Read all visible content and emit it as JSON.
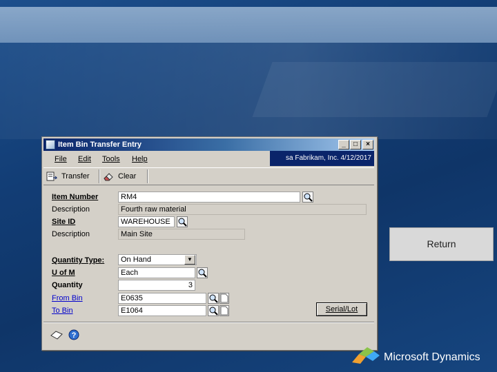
{
  "window": {
    "title": "Item Bin Transfer Entry",
    "controls": {
      "minimize": "_",
      "maximize": "□",
      "close": "×"
    }
  },
  "menu": {
    "items": [
      "File",
      "Edit",
      "Tools",
      "Help"
    ]
  },
  "user_info": "sa  Fabrikam, Inc.  4/12/2017",
  "toolbar": {
    "transfer_label": "Transfer",
    "clear_label": "Clear"
  },
  "form": {
    "item_number_label": "Item Number",
    "item_number_value": "RM4",
    "item_description_label": "Description",
    "item_description_value": "Fourth raw material",
    "site_id_label": "Site ID",
    "site_id_value": "WAREHOUSE",
    "site_description_label": "Description",
    "site_description_value": "Main Site",
    "quantity_type_label": "Quantity Type:",
    "quantity_type_value": "On Hand",
    "uom_label": "U of M",
    "uom_value": "Each",
    "quantity_label": "Quantity",
    "quantity_value": "3",
    "from_bin_label": "From Bin",
    "from_bin_value": "E0635",
    "to_bin_label": "To Bin",
    "to_bin_value": "E1064",
    "serial_lot_button": "Serial/Lot"
  },
  "side": {
    "return_button": "Return"
  },
  "branding": {
    "logo_text": "Microsoft Dynamics"
  },
  "colors": {
    "title_bar": "#0a246a",
    "window_bg": "#d4d0c8",
    "background": "#123d75"
  }
}
